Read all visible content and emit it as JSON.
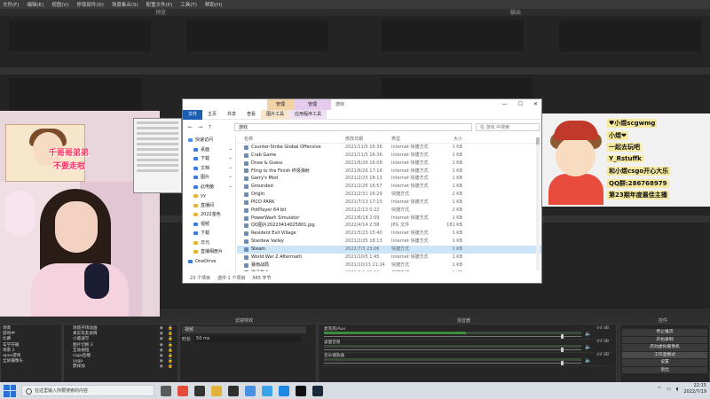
{
  "menubar": [
    "文件(F)",
    "编辑(E)",
    "视图(V)",
    "停靠部件(D)",
    "场景集合(S)",
    "配置文件(P)",
    "工具(T)",
    "帮助(H)"
  ],
  "panes": {
    "preview_label": "预览",
    "program_label": "输出"
  },
  "overlay_left": {
    "line1": "千哥哥弟弟",
    "line2": "不要走啦"
  },
  "overlay_right": {
    "lines": [
      "♥小煜scgwmg",
      "小煜❤",
      "一起去玩吧",
      "Y_Rstuffk",
      "和小煜csgo开心大乐",
      "QQ群:286768979",
      "第23期年度最佳主播"
    ]
  },
  "explorer": {
    "manage_tab1": "管理",
    "manage_tab2": "管理",
    "window_title": "游戏",
    "ribbon_tabs": [
      "文件",
      "主页",
      "共享",
      "查看",
      "图片工具",
      "应用程序工具"
    ],
    "path": "游戏",
    "search_placeholder": "在 游戏 中搜索",
    "columns": {
      "name": "名称",
      "date": "修改日期",
      "type": "类型",
      "size": "大小"
    },
    "nav": [
      {
        "label": "快速访问",
        "kind": "star",
        "pin": false
      },
      {
        "label": "桌面",
        "kind": "blue",
        "pin": true
      },
      {
        "label": "下载",
        "kind": "blue",
        "pin": true
      },
      {
        "label": "文档",
        "kind": "blue",
        "pin": true
      },
      {
        "label": "图片",
        "kind": "blue",
        "pin": true
      },
      {
        "label": "此电脑",
        "kind": "blue",
        "pin": true
      },
      {
        "label": "yy",
        "kind": "folder",
        "pin": false
      },
      {
        "label": "直播间",
        "kind": "folder",
        "pin": false
      },
      {
        "label": "2022金色",
        "kind": "folder",
        "pin": false
      },
      {
        "label": "视频",
        "kind": "blue",
        "pin": false
      },
      {
        "label": "下载",
        "kind": "blue",
        "pin": false
      },
      {
        "label": "日元",
        "kind": "folder",
        "pin": false
      },
      {
        "label": "直播相册片",
        "kind": "folder",
        "pin": false
      },
      {
        "label": "OneDrive",
        "kind": "blue",
        "pin": false
      }
    ],
    "files": [
      {
        "name": "Counter-Strike Global Offensive",
        "date": "2021/11/5 16:36",
        "type": "Internet 快捷方式",
        "size": "1 KB"
      },
      {
        "name": "Crab Game",
        "date": "2021/11/5 16:36",
        "type": "Internet 快捷方式",
        "size": "1 KB"
      },
      {
        "name": "Draw & Guess",
        "date": "2021/6/26 16:08",
        "type": "Internet 快捷方式",
        "size": "1 KB"
      },
      {
        "name": "Fling to the Finish 终极弹射",
        "date": "2021/6/26 17:16",
        "type": "Internet 快捷方式",
        "size": "1 KB"
      },
      {
        "name": "Garry's Mod",
        "date": "2021/2/25 18:13",
        "type": "Internet 快捷方式",
        "size": "1 KB"
      },
      {
        "name": "Grounded",
        "date": "2021/2/25 16:57",
        "type": "Internet 快捷方式",
        "size": "1 KB"
      },
      {
        "name": "Origin",
        "date": "2021/2/31 16:29",
        "type": "快捷方式",
        "size": "2 KB"
      },
      {
        "name": "PICO PARK",
        "date": "2021/7/13 17:10",
        "type": "Internet 快捷方式",
        "size": "1 KB"
      },
      {
        "name": "PotPlayer 64 bit",
        "date": "2021/2/13 0:22",
        "type": "快捷方式",
        "size": "2 KB"
      },
      {
        "name": "PowerWash Simulator",
        "date": "2021/6/18 2:09",
        "type": "Internet 快捷方式",
        "size": "1 KB"
      },
      {
        "name": "QQ图片20220414025801.jpg",
        "date": "2022/4/14 2:58",
        "type": "JPG 文件",
        "size": "181 KB"
      },
      {
        "name": "Resident Evil Village",
        "date": "2021/5/23 15:40",
        "type": "Internet 快捷方式",
        "size": "1 KB"
      },
      {
        "name": "Stardew Valley",
        "date": "2021/2/25 18:13",
        "type": "Internet 快捷方式",
        "size": "1 KB"
      },
      {
        "name": "Steam",
        "date": "2022/7/3 23:06",
        "type": "快捷方式",
        "size": "1 KB"
      },
      {
        "name": "World War Z Aftermath",
        "date": "2021/10/5 1:45",
        "type": "Internet 快捷方式",
        "size": "1 KB"
      },
      {
        "name": "暴雨战局",
        "date": "2021/10/13 21:24",
        "type": "快捷方式",
        "size": "1 KB"
      },
      {
        "name": "腾讯督卡",
        "date": "2021/3/4 20:52",
        "type": "快捷方式",
        "size": "1 KB"
      }
    ],
    "selected_file_index": 13,
    "status": {
      "count": "23 个项目",
      "selected": "选中 1 个项目",
      "size": "565 字节"
    }
  },
  "docks": {
    "scenes_title": "场景",
    "sources_title": "来源",
    "filters_title": "滤镜特效",
    "mixer_title": "混音器",
    "controls_title": "控件",
    "scenes": [
      "场景",
      "游戏中",
      "比赛",
      "玄学开箱",
      "场景 2",
      "apex游戏",
      "全屏摄像头"
    ],
    "sources": [
      "场景开场动画",
      "真实玩友表情",
      "小鹿速写",
      "图片切换 2",
      "互动按钮",
      "csgo直播",
      "yygp",
      "鼎祥加"
    ],
    "filter_name": "视频",
    "filter_label": "时长",
    "filter_value": "50 ms",
    "mixer": [
      {
        "name": "麦克风/Aux",
        "db": "-inf dB",
        "level": 0.55,
        "volume": 0.92
      },
      {
        "name": "桌面音频",
        "db": "-inf dB",
        "level": 0.0,
        "volume": 0.92
      },
      {
        "name": "音乐播放器",
        "db": "-inf dB",
        "level": 0.0,
        "volume": 0.92
      }
    ],
    "controls": [
      "停止推流",
      "开始录制",
      "启动虚拟摄像机",
      "工作室模式",
      "设置",
      "退出"
    ],
    "active_control": 3
  },
  "taskbar": {
    "search_placeholder": "在这里输入你要搜索的内容",
    "time": "22:15",
    "date": "2022/7/19",
    "icons": [
      "task-view-icon",
      "chrome-icon",
      "obs-icon",
      "explorer-icon",
      "terminal-icon",
      "app-icon",
      "bilibili-icon",
      "qq-icon",
      "douyin-icon",
      "steam-icon"
    ]
  }
}
